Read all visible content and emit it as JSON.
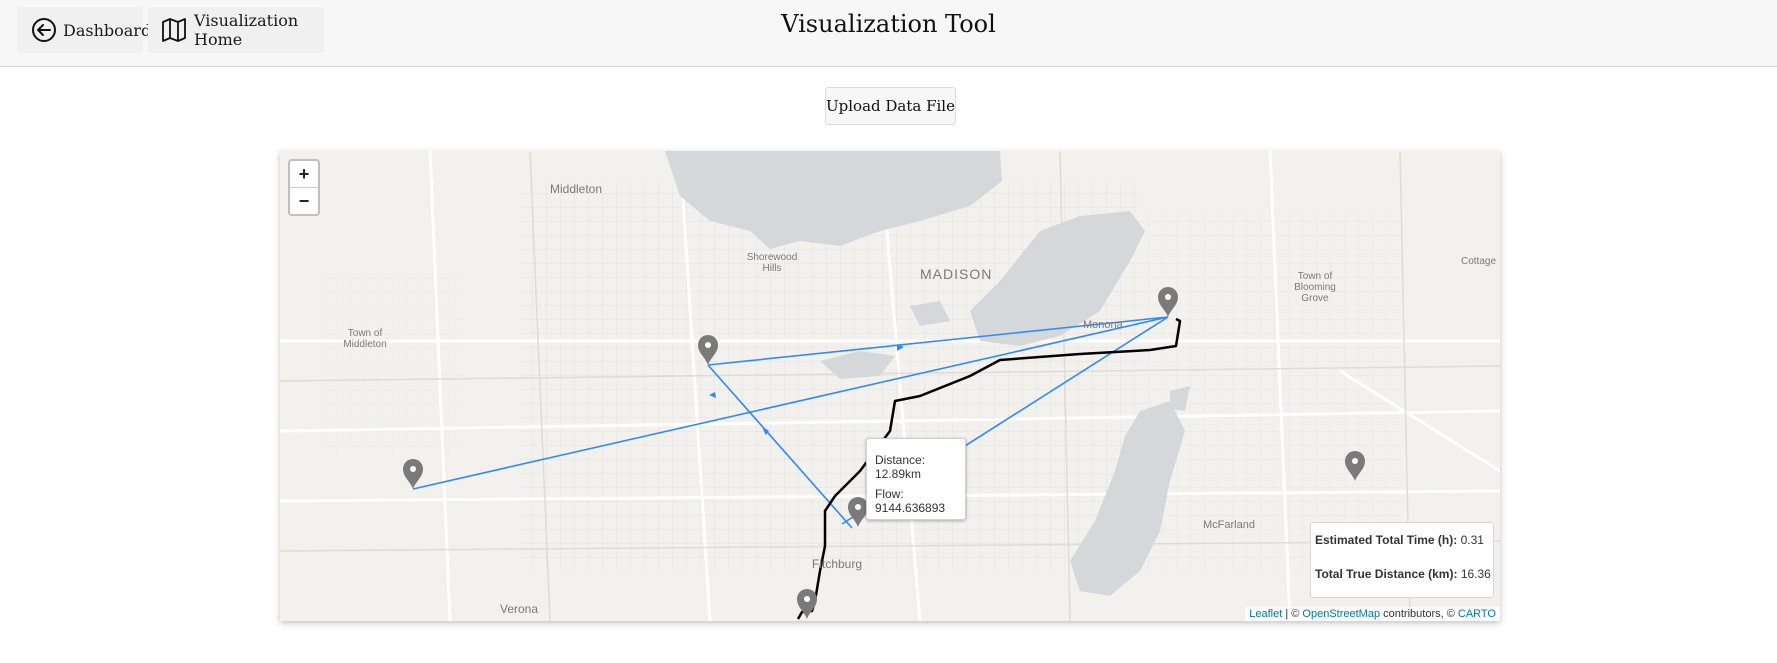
{
  "header": {
    "dashboard_label": "Dashboard",
    "viz_home_label": "Visualization Home",
    "title": "Visualization Tool"
  },
  "toolbar": {
    "upload_label": "Upload Data File"
  },
  "map": {
    "zoom_in": "+",
    "zoom_out": "−",
    "place_labels": {
      "middleton": "Middleton",
      "shorewood_hills": "Shorewood Hills",
      "madison": "MADISON",
      "monona": "Monona",
      "town_of_middleton": "Town of Middleton",
      "town_of_blooming_grove": "Town of Blooming Grove",
      "cottage": "Cottage",
      "mcfarland": "McFarland",
      "fitchburg": "Fitchburg",
      "verona": "Verona"
    },
    "tooltip": {
      "distance": "Distance: 12.89km",
      "flow": "Flow: 9144.636893"
    },
    "stats": {
      "time_label": "Estimated Total Time (h):",
      "time_value": "0.31",
      "distance_label": "Total True Distance (km):",
      "distance_value": "16.36"
    },
    "attribution": {
      "leaflet": "Leaflet",
      "sep1": " | © ",
      "osm": "OpenStreetMap",
      "sep2": " contributors, © ",
      "carto": "CARTO"
    },
    "colors": {
      "route_line": "#3388ff",
      "true_path": "#000000",
      "marker": "#7a7a7a",
      "water": "#d4d8da"
    }
  }
}
